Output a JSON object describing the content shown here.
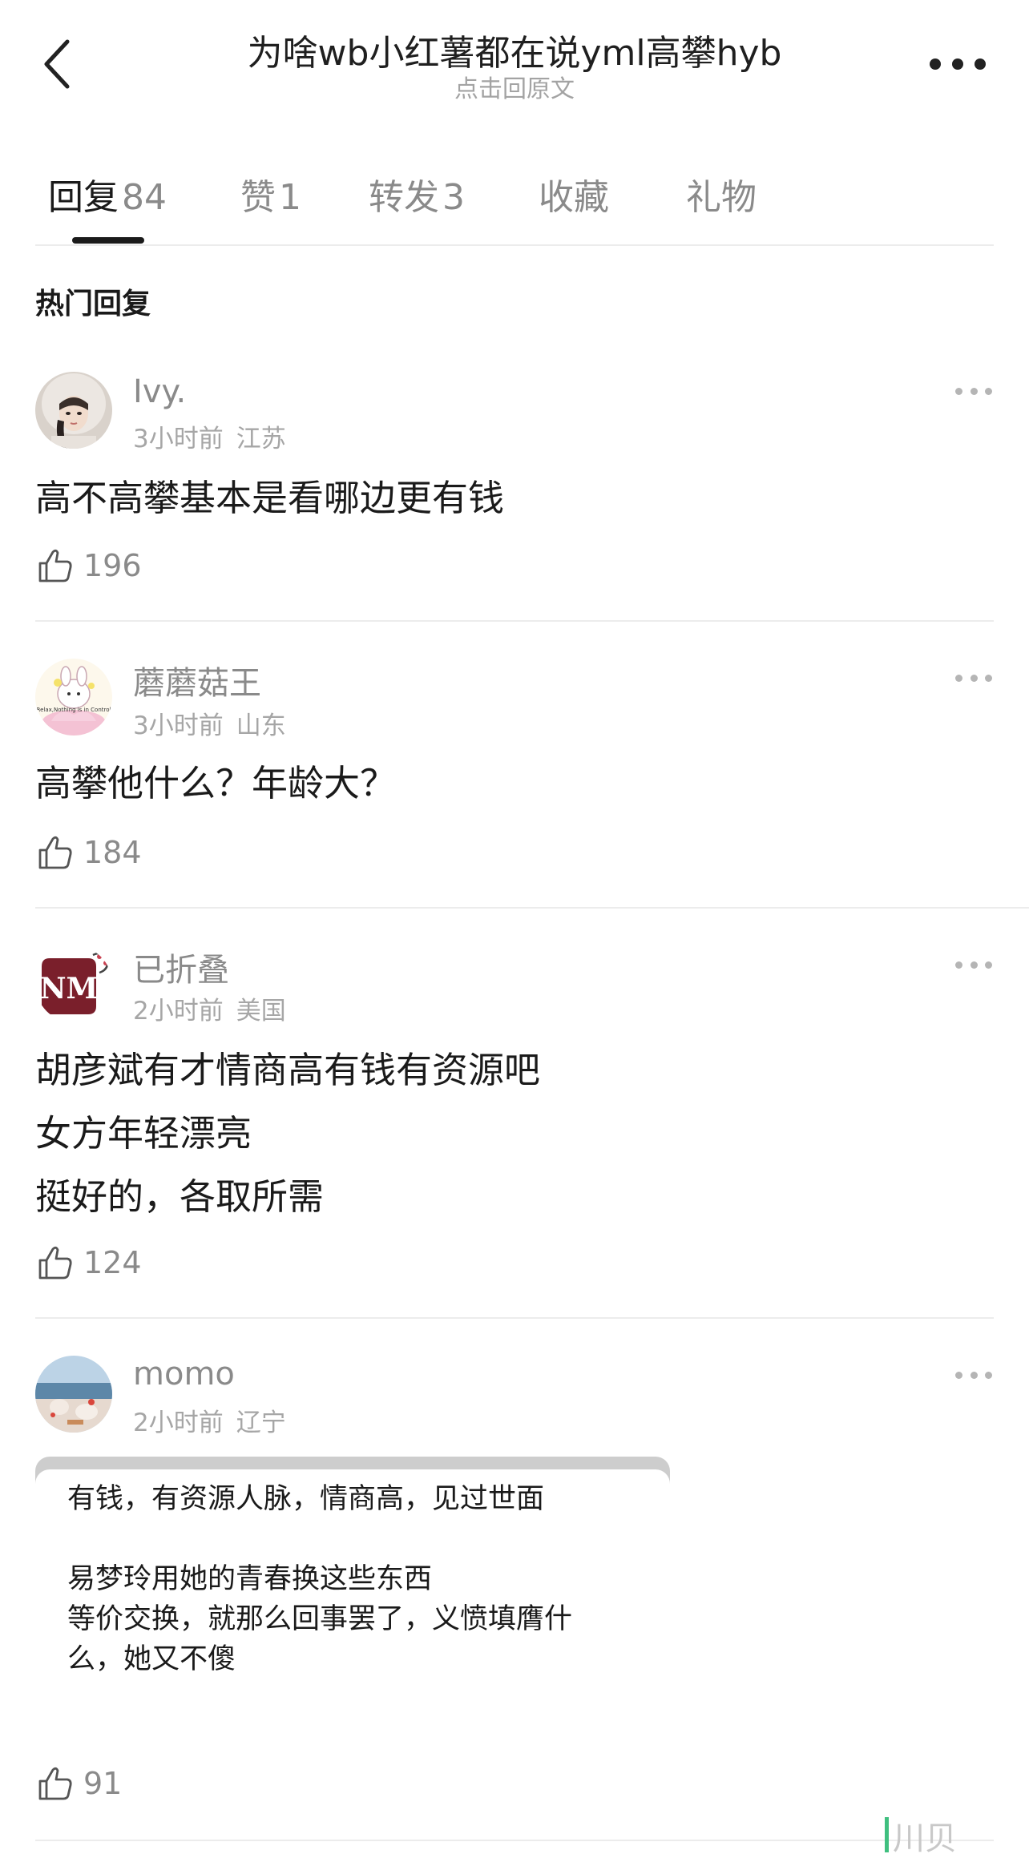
{
  "header": {
    "title": "为啥wb小红薯都在说yml高攀hyb",
    "subtitle": "点击回原文"
  },
  "tabs": [
    {
      "label": "回复",
      "count": "84"
    },
    {
      "label": "赞",
      "count": "1"
    },
    {
      "label": "转发",
      "count": "3"
    },
    {
      "label": "收藏",
      "count": ""
    },
    {
      "label": "礼物",
      "count": ""
    }
  ],
  "section_title": "热门回复",
  "comments": [
    {
      "username": "Ivy.",
      "time": "3小时前",
      "location": "江苏",
      "lines": [
        "高不高攀基本是看哪边更有钱"
      ],
      "likes": "196",
      "avatar": "girl-hooded-avatar"
    },
    {
      "username": "蘑蘑菇王",
      "time": "3小时前",
      "location": "山东",
      "lines": [
        "高攀他什么？年龄大？"
      ],
      "likes": "184",
      "avatar": "cartoon-rabbit-avatar",
      "avatar_text": "Relax,Nothing is in Control"
    },
    {
      "username": "已折叠",
      "time": "2小时前",
      "location": "美国",
      "lines": [
        "胡彦斌有才情商高有钱有资源吧",
        "女方年轻漂亮",
        "挺好的，各取所需"
      ],
      "likes": "124",
      "avatar": "nm-logo-avatar",
      "avatar_text": "NM"
    },
    {
      "username": "momo",
      "time": "2小时前",
      "location": "辽宁",
      "quote_lines": [
        "有钱，有资源人脉，情商高，见过世面",
        "",
        "易梦玲用她的青春换这些东西",
        "等价交换，就那么回事罢了，义愤填膺什",
        "么，她又不傻"
      ],
      "likes": "91",
      "avatar": "seaside-photo-avatar"
    }
  ],
  "watermark_text": "川贝",
  "colors": {
    "text_primary": "#1a1a1a",
    "text_secondary": "#8a8a8a",
    "text_tertiary": "#a6a6a6",
    "divider": "#ececec",
    "watermark_green": "#3fbf7f"
  }
}
